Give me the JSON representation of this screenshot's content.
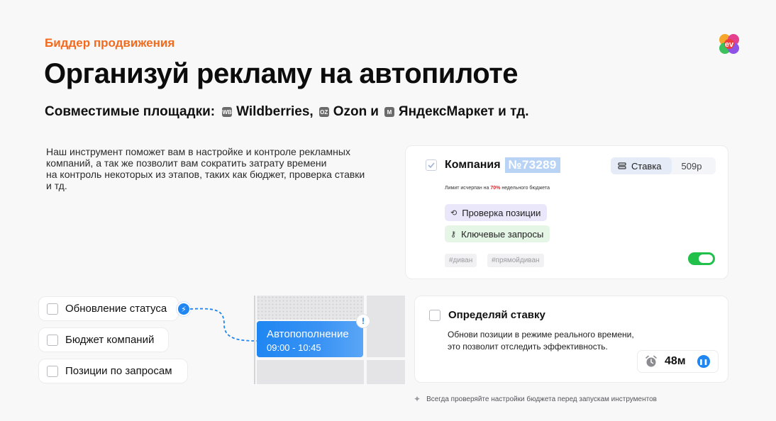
{
  "header": {
    "eyebrow": "Биддер продвижения",
    "title": "Организуй рекламу на автопилоте",
    "platforms_label": "Совместимые площадки:",
    "platforms": [
      {
        "icon": "wildberries-icon",
        "icon_text": "WB",
        "name": "Wildberries,"
      },
      {
        "icon": "ozon-icon",
        "icon_text": "OZ",
        "name": "Ozon"
      },
      {
        "icon": "yandexmarket-icon",
        "icon_text": "M",
        "name": "ЯндексМаркет и тд."
      }
    ],
    "platforms_joiner": "и"
  },
  "description_lines": [
    "Наш инструмент поможет вам в настройке и контроле рекламных",
    "компаний, а так же позволит вам сократить затрату времени",
    "на контроль некоторых из этапов, таких как бюджет, проверка ставки",
    "и тд."
  ],
  "campaign": {
    "name": "Компания",
    "number": "№73289",
    "stake_label": "Ставка",
    "stake_value": "509р",
    "limit_prefix": "Лимит исчерпан на",
    "limit_percent": "70%",
    "limit_suffix": "недельного бюджета",
    "pill_position": "Проверка позиции",
    "pill_keywords": "Ключевые запросы",
    "tags": [
      "#диван",
      "#прямойдиван"
    ],
    "enabled": true
  },
  "checklist": [
    "Обновление статуса",
    "Бюджет компаний",
    "Позиции по запросам"
  ],
  "autofill": {
    "title": "Автопополнение",
    "time": "09:00 - 10:45"
  },
  "stake_card": {
    "title": "Определяй ставку",
    "line1": "Обнови позиции в режиме реального времени,",
    "line2": "это позволит отследить эффективность.",
    "timer_value": "48м"
  },
  "footnote": "Всегда проверяйте настройки бюджета перед запускам инструментов",
  "colors": {
    "accent_orange": "#f36a1d",
    "accent_blue": "#1f86f2",
    "toggle_green": "#20c04a",
    "warning_red": "#d9262c"
  }
}
